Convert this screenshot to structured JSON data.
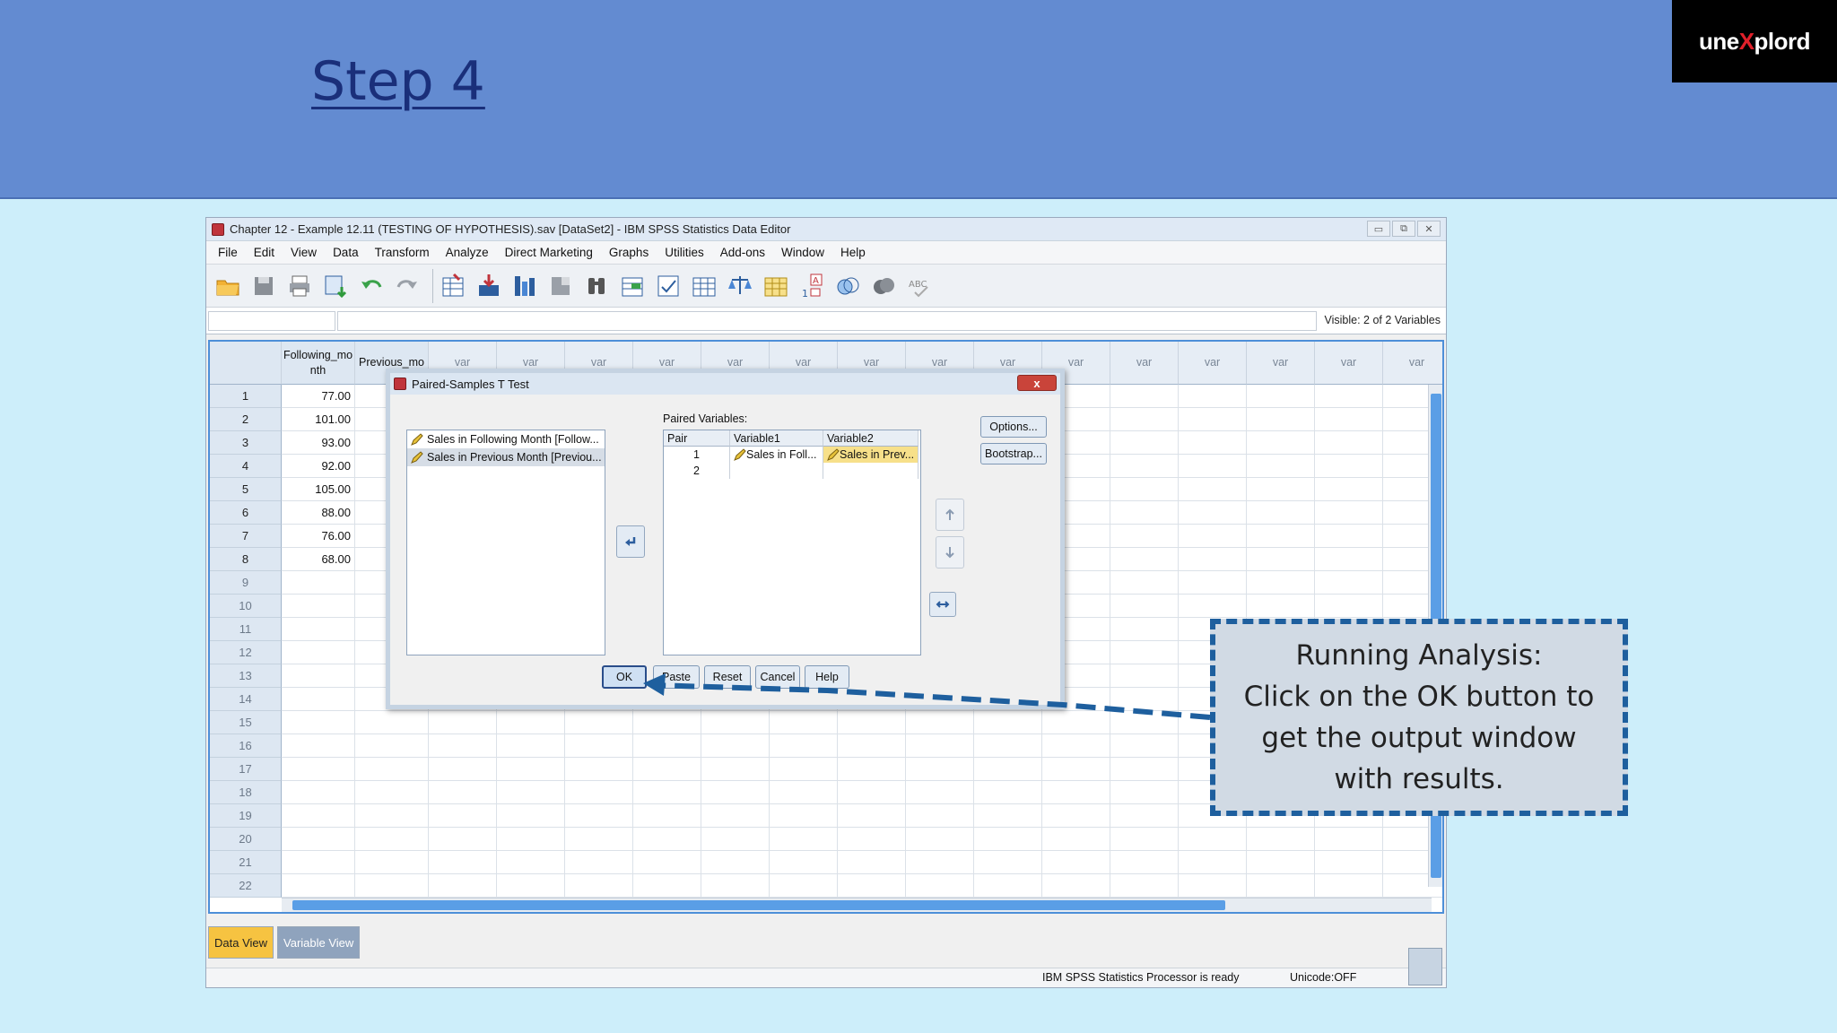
{
  "slide": {
    "title": "Step 4"
  },
  "logo": {
    "part1": "une",
    "part2": "X",
    "part3": "plord"
  },
  "window": {
    "title": "Chapter 12 - Example 12.11 (TESTING OF HYPOTHESIS).sav [DataSet2] - IBM SPSS Statistics Data Editor",
    "controls": [
      "▭",
      "⧉",
      "✕"
    ]
  },
  "menu": [
    "File",
    "Edit",
    "View",
    "Data",
    "Transform",
    "Analyze",
    "Direct Marketing",
    "Graphs",
    "Utilities",
    "Add-ons",
    "Window",
    "Help"
  ],
  "toolbar_icons": [
    "open-folder-icon",
    "save-icon",
    "print-icon",
    "recall-dialog-icon",
    "undo-icon",
    "redo-icon",
    "goto-case-icon",
    "goto-variable-icon",
    "variables-icon",
    "run-descriptives-icon",
    "find-icon",
    "insert-cases-icon",
    "insert-variable-icon",
    "split-file-icon",
    "weight-cases-icon",
    "select-cases-icon",
    "value-labels-icon",
    "use-sets-icon",
    "show-all-variables-icon",
    "spell-check-icon"
  ],
  "cellbar": {
    "visible": "Visible: 2 of 2 Variables"
  },
  "grid": {
    "columns": [
      "Following_mo\nnth",
      "Previous_mo",
      "var",
      "var",
      "var",
      "var",
      "var",
      "var",
      "var",
      "var",
      "var",
      "var",
      "var",
      "var",
      "var",
      "var",
      "var"
    ],
    "rows": [
      {
        "n": "1",
        "a": "77.00"
      },
      {
        "n": "2",
        "a": "101.00"
      },
      {
        "n": "3",
        "a": "93.00"
      },
      {
        "n": "4",
        "a": "92.00"
      },
      {
        "n": "5",
        "a": "105.00"
      },
      {
        "n": "6",
        "a": "88.00"
      },
      {
        "n": "7",
        "a": "76.00"
      },
      {
        "n": "8",
        "a": "68.00"
      },
      {
        "n": "9",
        "a": ""
      },
      {
        "n": "10",
        "a": ""
      },
      {
        "n": "11",
        "a": ""
      },
      {
        "n": "12",
        "a": ""
      },
      {
        "n": "13",
        "a": ""
      },
      {
        "n": "14",
        "a": ""
      },
      {
        "n": "15",
        "a": ""
      },
      {
        "n": "16",
        "a": ""
      },
      {
        "n": "17",
        "a": ""
      },
      {
        "n": "18",
        "a": ""
      },
      {
        "n": "19",
        "a": ""
      },
      {
        "n": "20",
        "a": ""
      },
      {
        "n": "21",
        "a": ""
      },
      {
        "n": "22",
        "a": ""
      }
    ]
  },
  "tabs": {
    "data_view": "Data View",
    "variable_view": "Variable View"
  },
  "status": {
    "ready": "IBM SPSS Statistics Processor is ready",
    "unicode": "Unicode:OFF"
  },
  "dialog": {
    "title": "Paired-Samples T Test",
    "close": "x",
    "source_items": [
      "Sales in Following Month [Follow...",
      "Sales in Previous Month [Previou..."
    ],
    "paired_label": "Paired Variables:",
    "table_headers": [
      "Pair",
      "Variable1",
      "Variable2"
    ],
    "pairs": [
      {
        "pair": "1",
        "v1": "Sales in Foll...",
        "v2": "Sales in Prev..."
      },
      {
        "pair": "2",
        "v1": "",
        "v2": ""
      }
    ],
    "options": "Options...",
    "bootstrap": "Bootstrap...",
    "ok": "OK",
    "paste": "Paste",
    "reset": "Reset",
    "cancel": "Cancel",
    "help": "Help"
  },
  "callout": {
    "text": "Running Analysis:\nClick on the OK button to\nget the output window\nwith results."
  },
  "colors": {
    "banner": "#638bd1",
    "title": "#1a2f7a",
    "callout_border": "#1e5f9e",
    "active_tab": "#f6c341"
  }
}
